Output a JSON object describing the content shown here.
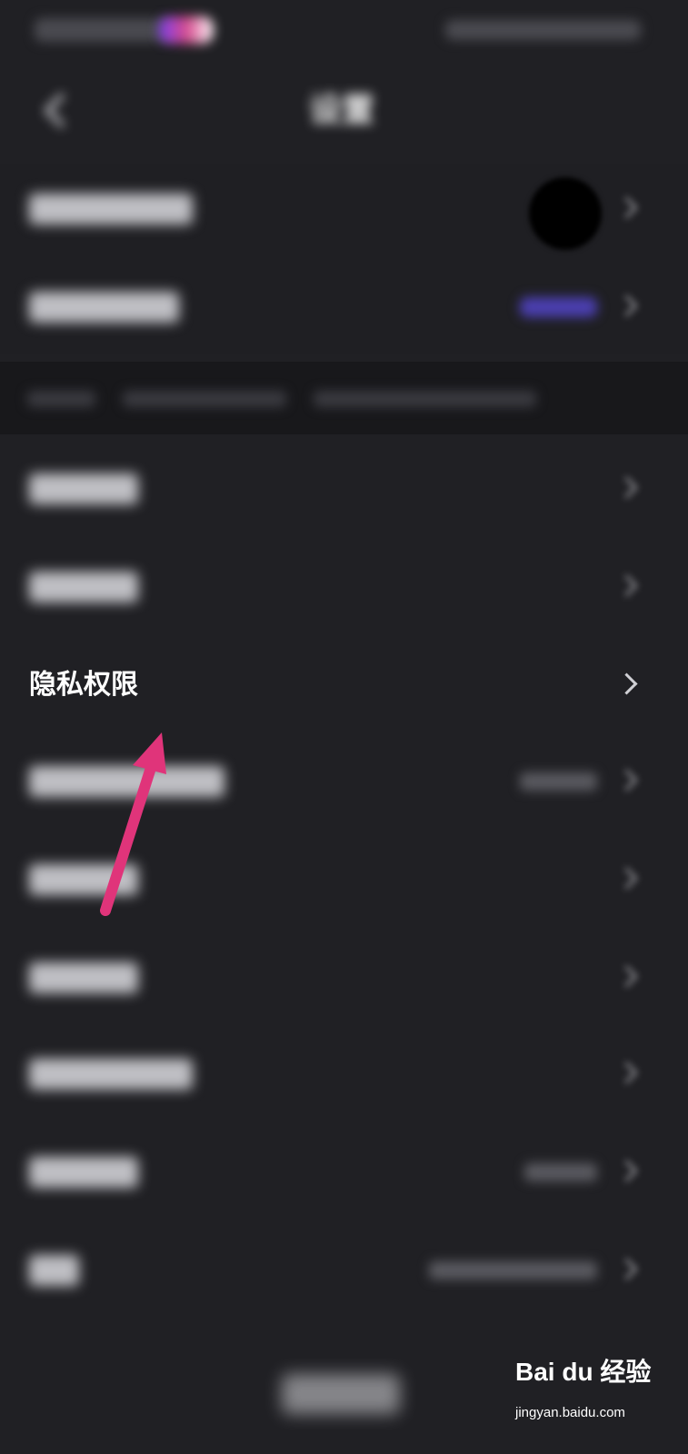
{
  "header": {
    "title": "设置"
  },
  "menu": {
    "highlighted_item": "隐私权限"
  },
  "watermark": {
    "brand": "Bai du 经验",
    "url": "jingyan.baidu.com"
  },
  "colors": {
    "background": "#202024",
    "text": "#ffffff",
    "arrow": "#e0347a"
  }
}
